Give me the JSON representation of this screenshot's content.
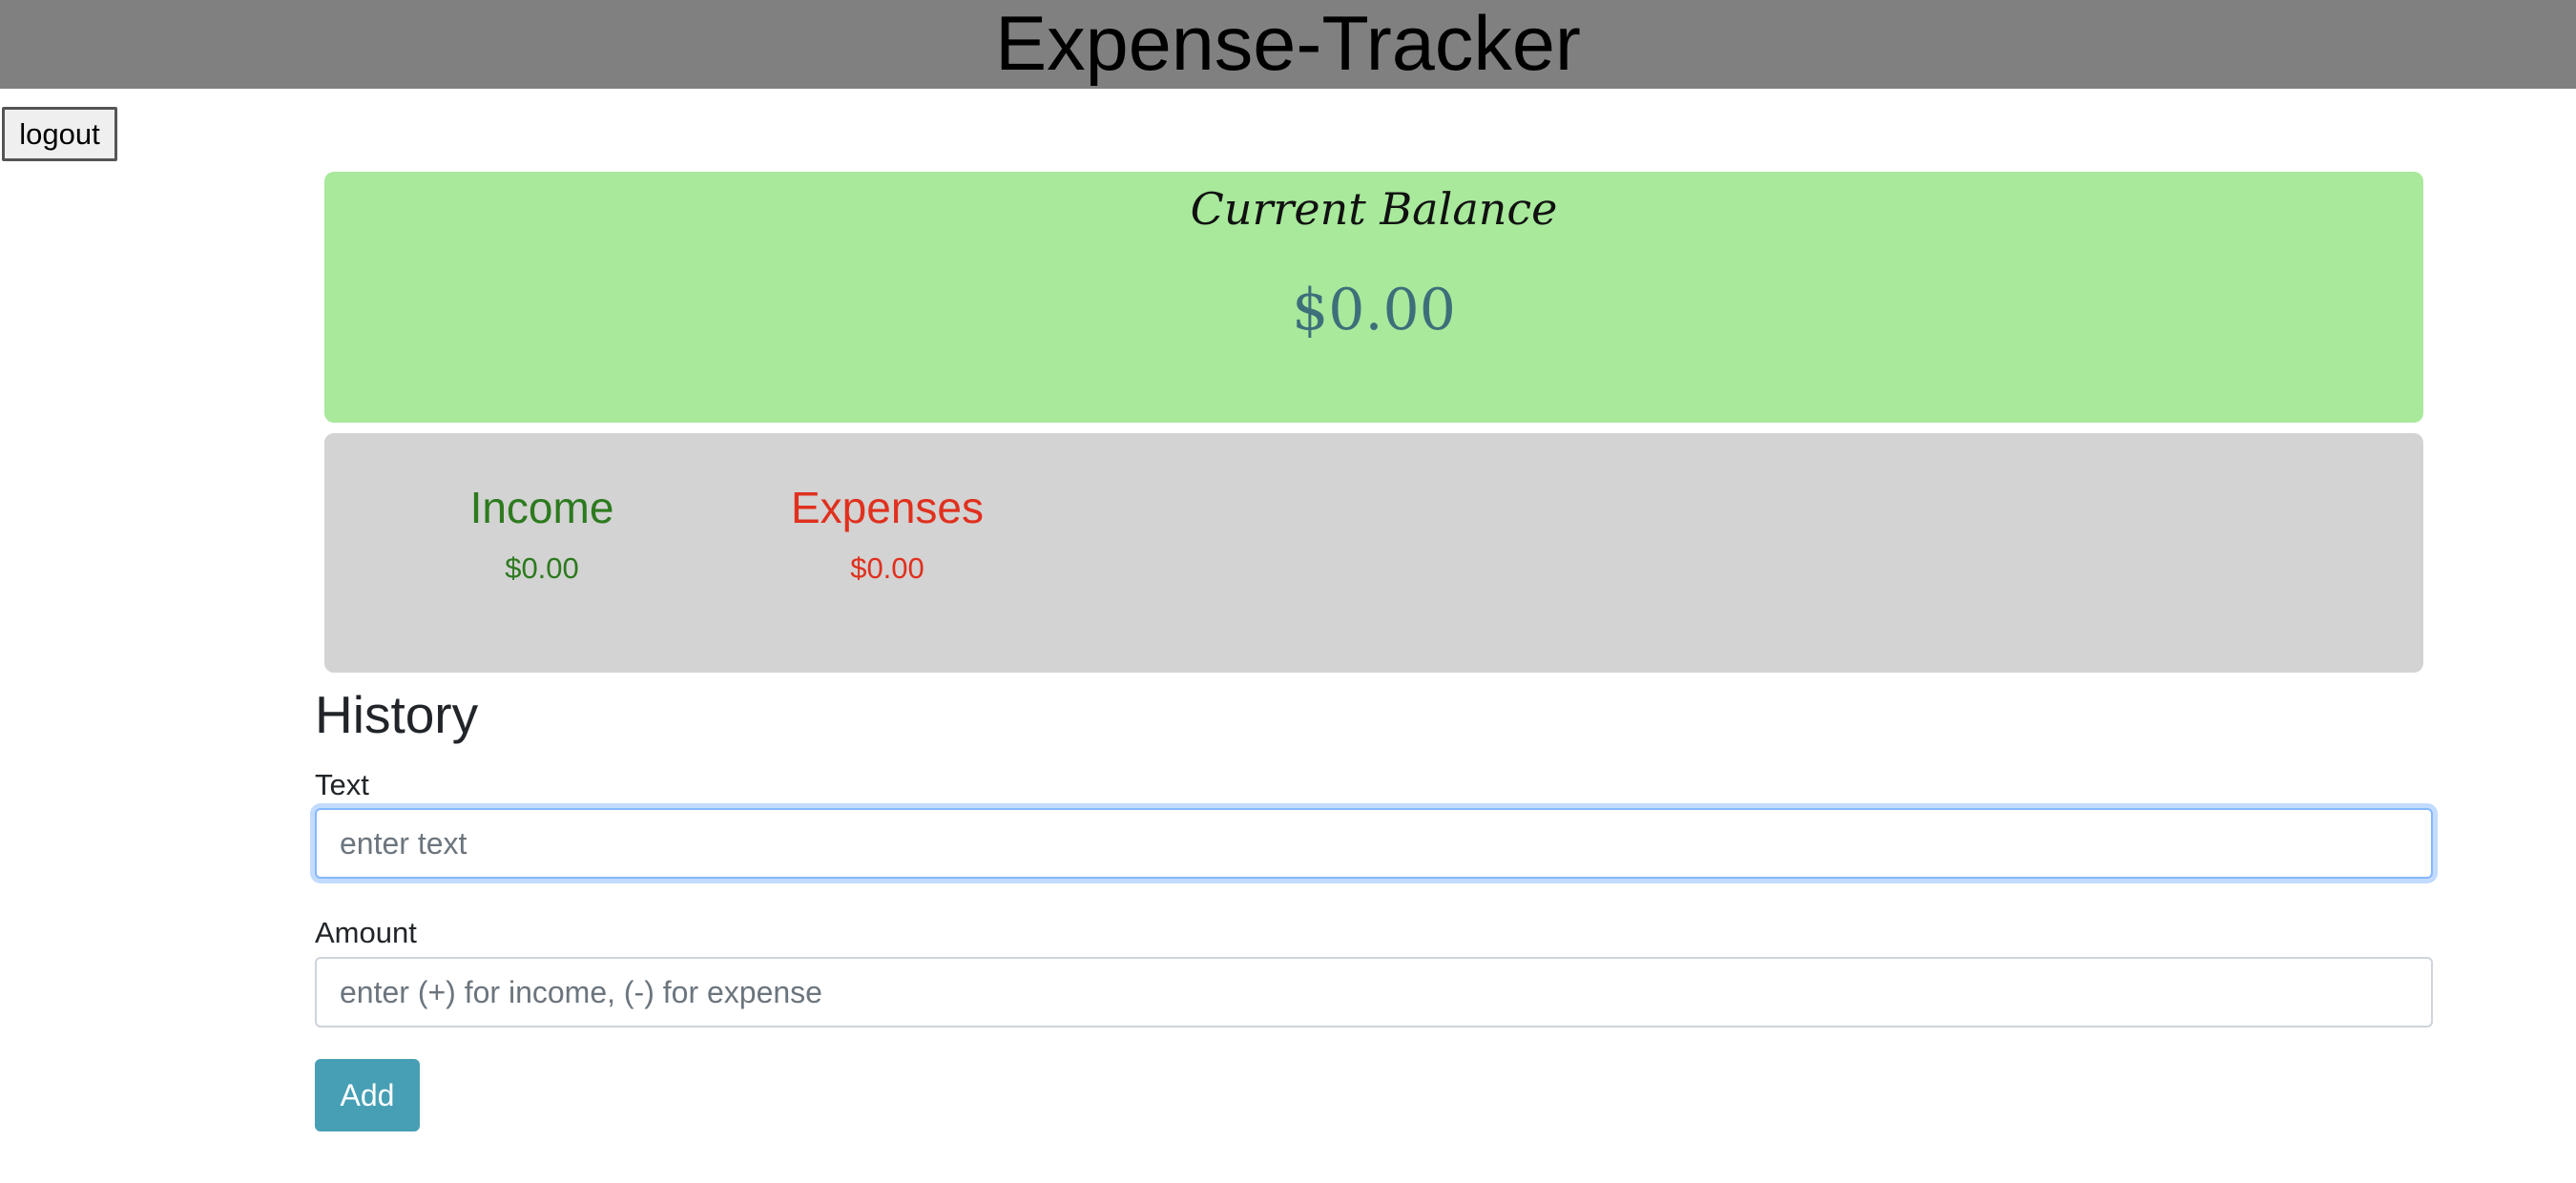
{
  "header": {
    "title": "Expense-Tracker"
  },
  "auth": {
    "logout_label": "logout"
  },
  "balance": {
    "title": "Current Balance",
    "value": "$0.00"
  },
  "summary": {
    "income_label": "Income",
    "income_value": "$0.00",
    "expense_label": "Expenses",
    "expense_value": "$0.00"
  },
  "history": {
    "heading": "History"
  },
  "form": {
    "text_label": "Text",
    "text_value": "",
    "text_placeholder": "enter text",
    "amount_label": "Amount",
    "amount_value": "",
    "amount_placeholder": "enter (+) for income, (-) for expense",
    "add_label": "Add"
  },
  "colors": {
    "header_bg": "#808080",
    "balance_bg": "#a8e99b",
    "summary_bg": "#d3d3d3",
    "income": "#2d7a1f",
    "expense": "#e0301e",
    "add_button": "#479fb5"
  }
}
